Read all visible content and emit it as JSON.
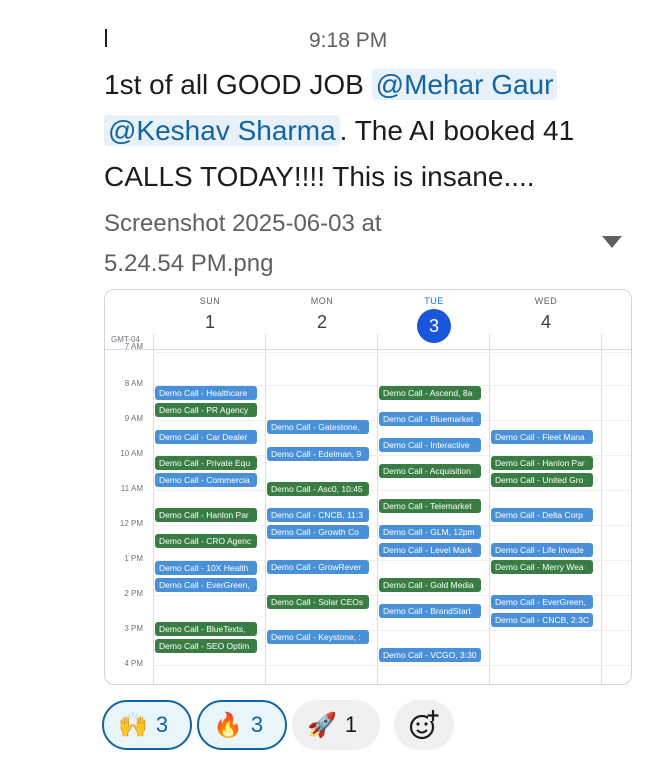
{
  "timestamp": "9:18 PM",
  "message": {
    "part1": "1st of all GOOD JOB ",
    "mention1": "@Mehar Gaur",
    "mention2": "@Keshav Sharma",
    "part2": ". The AI booked 41 CALLS TODAY!!!! This is insane...."
  },
  "attachment": {
    "filename": "Screenshot 2025-06-03 at 5.24.54 PM.png"
  },
  "calendar": {
    "timezone": "GMT-04",
    "days": [
      {
        "dow": "SUN",
        "num": "1"
      },
      {
        "dow": "MON",
        "num": "2"
      },
      {
        "dow": "TUE",
        "num": "3"
      },
      {
        "dow": "WED",
        "num": "4"
      }
    ],
    "times": [
      "7 AM",
      "8 AM",
      "9 AM",
      "10 AM",
      "11 AM",
      "12 PM",
      "1 PM",
      "2 PM",
      "3 PM",
      "4 PM"
    ],
    "events": {
      "sun": [
        {
          "label": "Demo Call - Healthcare",
          "color": "#4a90d9"
        },
        {
          "label": "Demo Call - PR Agency",
          "color": "#3a7d44"
        },
        {
          "label": "Demo Call - Car Dealer",
          "color": "#4a90d9"
        },
        {
          "label": "Demo Call - Private Equ",
          "color": "#3a7d44"
        },
        {
          "label": "Demo Call - Commercia",
          "color": "#4a90d9"
        },
        {
          "label": "Demo Call - Hanlon Par",
          "color": "#3a7d44"
        },
        {
          "label": "Demo Call - CRO Agenc",
          "color": "#3a7d44"
        },
        {
          "label": "Demo Call - 10X Health",
          "color": "#4a90d9"
        },
        {
          "label": "Demo Call - EverGreen,",
          "color": "#4a90d9"
        },
        {
          "label": "Demo Call - BlueTexts,",
          "color": "#3a7d44"
        },
        {
          "label": "Demo Call - SEO Optim",
          "color": "#3a7d44"
        }
      ],
      "mon": [
        {
          "label": "Demo Call - Gatestone,",
          "color": "#4a90d9"
        },
        {
          "label": "Demo Call - Edelman, 9",
          "color": "#4a90d9"
        },
        {
          "label": "Demo Call - Asc0, 10:45",
          "color": "#3a7d44"
        },
        {
          "label": "Demo Call - CNCB, 11:3",
          "color": "#4a90d9"
        },
        {
          "label": "Demo Call - Growth Co",
          "color": "#4a90d9"
        },
        {
          "label": "Demo Call - GrowRever",
          "color": "#4a90d9"
        },
        {
          "label": "Demo Call - Solar CEOs",
          "color": "#3a7d44"
        },
        {
          "label": "Demo Call - Keystone, :",
          "color": "#4a90d9"
        }
      ],
      "tue": [
        {
          "label": "Demo Call - Ascend, 8a",
          "color": "#3a7d44"
        },
        {
          "label": "Demo Call - Bluemarket",
          "color": "#4a90d9"
        },
        {
          "label": "Demo Call - Interactive",
          "color": "#4a90d9"
        },
        {
          "label": "Demo Call - Acquisition",
          "color": "#3a7d44"
        },
        {
          "label": "Demo Call - Telemarket",
          "color": "#3a7d44"
        },
        {
          "label": "Demo Call - GLM, 12pm",
          "color": "#4a90d9"
        },
        {
          "label": "Demo Call - Level Mark",
          "color": "#4a90d9"
        },
        {
          "label": "Demo Call - Gold Media",
          "color": "#3a7d44"
        },
        {
          "label": "Demo Call - BrandStart",
          "color": "#4a90d9"
        },
        {
          "label": "Demo Call - VCGO, 3:30",
          "color": "#4a90d9"
        }
      ],
      "wed": [
        {
          "label": "Demo Call - Fleet Mana",
          "color": "#4a90d9"
        },
        {
          "label": "Demo Call - Hanlon Par",
          "color": "#3a7d44"
        },
        {
          "label": "Demo Call - United Gro",
          "color": "#3a7d44"
        },
        {
          "label": "Demo Call - Delta Corp",
          "color": "#4a90d9"
        },
        {
          "label": "Demo Call - Life Invade",
          "color": "#4a90d9"
        },
        {
          "label": "Demo Call - Merry Wea",
          "color": "#3a7d44"
        },
        {
          "label": "Demo Call - EverGreen,",
          "color": "#4a90d9"
        },
        {
          "label": "Demo Call - CNCB, 2:3C",
          "color": "#4a90d9"
        }
      ]
    }
  },
  "reactions": [
    {
      "emoji": "🙌",
      "icon": "raised-hands-icon",
      "count": "3",
      "mine": true
    },
    {
      "emoji": "🔥",
      "icon": "fire-icon",
      "count": "3",
      "mine": true
    },
    {
      "emoji": "🚀",
      "icon": "rocket-icon",
      "count": "1",
      "mine": false
    }
  ]
}
